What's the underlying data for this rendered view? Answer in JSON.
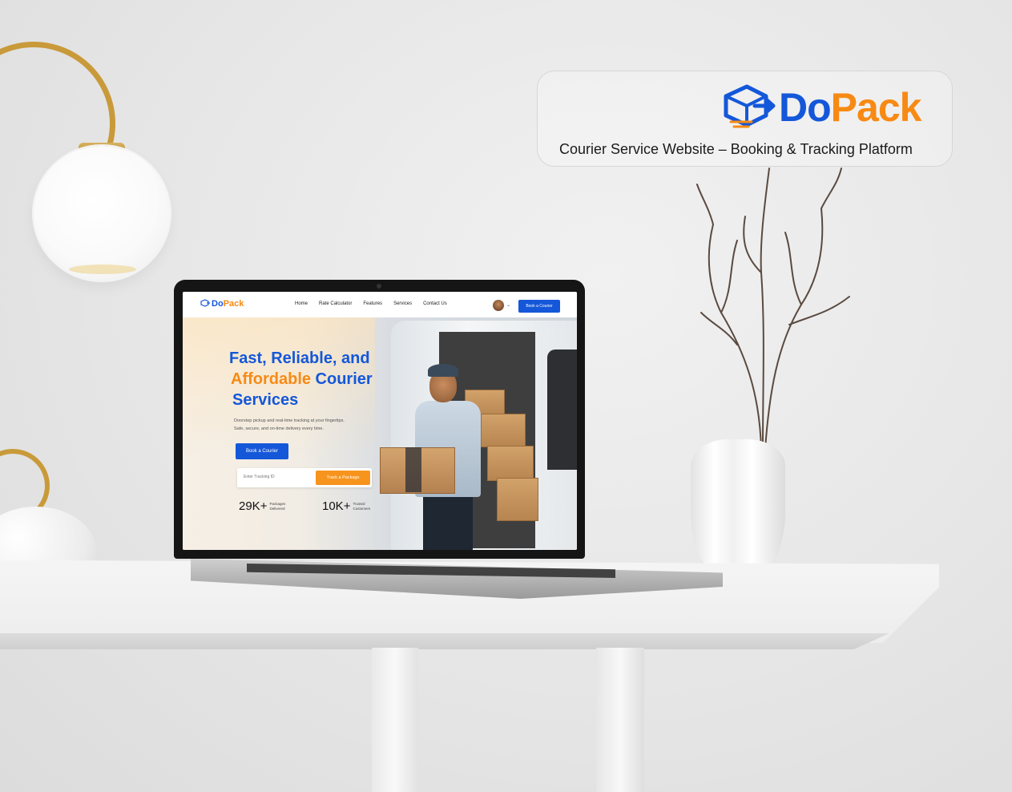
{
  "brand": {
    "name_part1": "Do",
    "name_part2": "Pack",
    "tagline": "Courier Service Website – Booking & Tracking Platform",
    "colors": {
      "primary": "#1457d9",
      "accent": "#f78a14"
    }
  },
  "website": {
    "nav": {
      "logo_part1": "Do",
      "logo_part2": "Pack",
      "links": [
        "Home",
        "Rate Calculator",
        "Features",
        "Services",
        "Contact Us"
      ],
      "cta": "Book a Courier",
      "avatar_icon": "user-avatar-icon",
      "chevron_icon": "chevron-down-icon"
    },
    "hero": {
      "title_line1": "Fast, Reliable, and",
      "title_line2_accent": "Affordable",
      "title_line2_rest": " Courier",
      "title_line3": "Services",
      "subtitle_line1": "Doorstep pickup and real-time tracking at your fingertips.",
      "subtitle_line2": "Safe, secure, and on-time delivery every time.",
      "primary_button": "Book a Courier",
      "tracking_placeholder": "Enter Tracking ID",
      "tracking_button": "Track a Package",
      "stats": [
        {
          "value": "29K+",
          "label_line1": "Packages",
          "label_line2": "Delivered"
        },
        {
          "value": "10K+",
          "label_line1": "Trusted",
          "label_line2": "Customers"
        }
      ]
    }
  }
}
